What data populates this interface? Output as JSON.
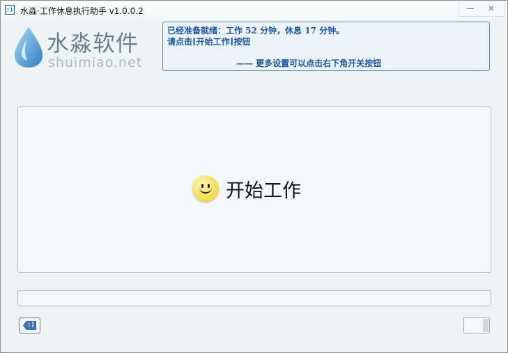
{
  "window": {
    "title": "水淼·工作休息执行助手 v1.0.0.2",
    "app_icon_glyph": ":)",
    "minimize_icon": "minimize-icon",
    "close_icon": "close-icon",
    "close_glyph": "✕"
  },
  "logo": {
    "name": "水淼软件",
    "url": "shuimiao.net",
    "drop_color": "#4a9fd6"
  },
  "notice": {
    "line1": "已经准备就绪：工作 52 分钟，休息 17 分钟。",
    "line2": "请点击[开始工作]按钮",
    "line3": "—— 更多设置可以点击右下角开关按钮"
  },
  "main": {
    "start_label": "开始工作",
    "start_icon": "smiley-icon"
  },
  "progress": {
    "percent": 0
  },
  "footer": {
    "tag_glyph": ":)",
    "tag_icon": "tag-icon",
    "toggle_on": false
  },
  "colors": {
    "accent": "#1c57a4",
    "panel_border": "#5c88b3",
    "background": "#eef3f4"
  }
}
